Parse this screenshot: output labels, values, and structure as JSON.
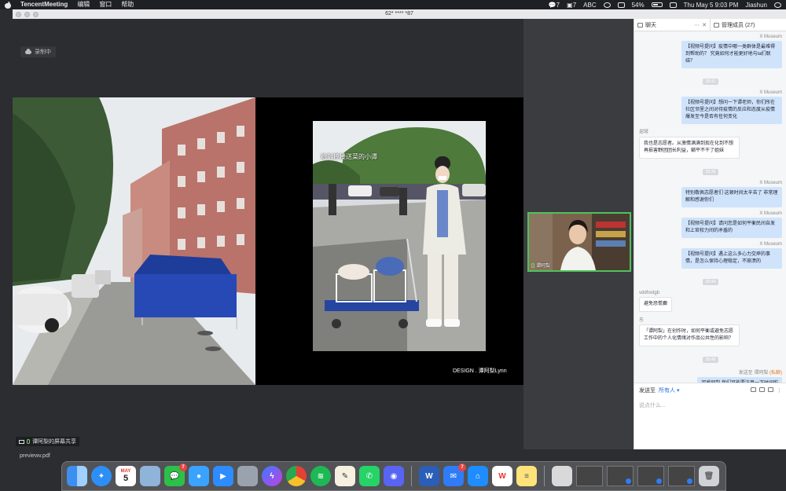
{
  "menubar": {
    "app_name": "TencentMeeting",
    "menus": [
      "编辑",
      "窗口",
      "帮助"
    ],
    "status": {
      "wechat_count": "7",
      "notif_count": "7",
      "input_method": "ABC",
      "battery": "54%",
      "datetime": "Thu May 5  9:03 PM",
      "user": "Jiashun"
    }
  },
  "window": {
    "title": "62* **** *87",
    "recording_label": "录制中",
    "slide": {
      "photo_overlay_text": "给封控楼送菜的小谭",
      "caption": "DESIGN . 谭阿梨Lynn"
    },
    "share_label": "谭阿梨的屏幕共享",
    "video_tile_name": "谭阿梨"
  },
  "chat": {
    "tab_chat": "聊天",
    "tab_members": "管理成员 (27)",
    "messages": [
      {
        "kind": "self",
        "sender": "X Museum",
        "text": "【视频号提问】疫情中哪一类群体是最难得到帮助的？ 究竟如何才能更好地与ta们联结？"
      },
      {
        "kind": "time",
        "text": "20:31"
      },
      {
        "kind": "self",
        "sender": "X Museum",
        "text": "【视频号提问】想问一下谭老师，你们所在社区邻里之间对待疫情的反应和态度从疫情爆发至今是否有任何变化"
      },
      {
        "kind": "other",
        "sender": "郑琴",
        "text": "我也是志愿者。从激情满满到现在化到不想再损害野团团长利益，躺平不干了姐妹"
      },
      {
        "kind": "time",
        "text": "20:36"
      },
      {
        "kind": "self",
        "sender": "X Museum",
        "text": "特别敬佩志愿者们 这顿时间太辛苦了 非常理解和感谢你们"
      },
      {
        "kind": "self",
        "sender": "X Museum",
        "text": "【视频号提问】请问您是如何平衡民间自发和上官权力间的矛盾的"
      },
      {
        "kind": "self",
        "sender": "X Museum",
        "text": "【视频号提问】遇上这么多心力交瘁的事情，是怎么保持心理稳定，不崩溃的"
      },
      {
        "kind": "time",
        "text": "20:44"
      },
      {
        "kind": "other",
        "sender": "vddhxdgb",
        "text": "避免恐慌癫"
      },
      {
        "kind": "other",
        "sender": "东",
        "text": "「谭阿梨」在创作时，如何平衡或避免志愿工作中的个人化情绪对作品公共性的影响？"
      },
      {
        "kind": "time",
        "text": "20:49"
      },
      {
        "kind": "self",
        "sender": "发送至 谭阿梨",
        "private": "(私聊)",
        "text": "可爱阿梨 我们可能要注意一下时间啦"
      }
    ],
    "input": {
      "send_to_label": "发送至",
      "send_to_value": "所有人",
      "placeholder": "说点什么..."
    }
  },
  "desktop": {
    "file_label": "previewv.pdf"
  },
  "dock": {
    "calendar_date": "5",
    "calendar_month": "MAY",
    "wechat_badge": "7",
    "mail_badge": "7"
  }
}
